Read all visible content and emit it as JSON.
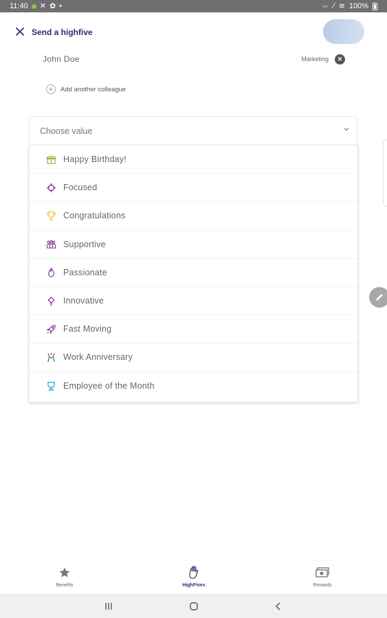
{
  "status_bar": {
    "time": "11:40",
    "battery": "100%"
  },
  "header": {
    "title": "Send a highfive"
  },
  "recipient": {
    "name": "John Doe",
    "department": "Marketing"
  },
  "add_colleague": {
    "label": "Add another colleague"
  },
  "select": {
    "label": "Choose value"
  },
  "options": [
    {
      "label": "Happy Birthday!",
      "icon": "gift-icon",
      "color": "#8bc34a"
    },
    {
      "label": "Focused",
      "icon": "crosshair-icon",
      "color": "#7b2d8e"
    },
    {
      "label": "Congratulations",
      "icon": "trophy-icon",
      "color": "#f4c430"
    },
    {
      "label": "Supportive",
      "icon": "team-icon",
      "color": "#7b2d8e"
    },
    {
      "label": "Passionate",
      "icon": "flame-icon",
      "color": "#7b2d8e"
    },
    {
      "label": "Innovative",
      "icon": "bulb-icon",
      "color": "#7b2d8e"
    },
    {
      "label": "Fast Moving",
      "icon": "rocket-icon",
      "color": "#7b2d8e"
    },
    {
      "label": "Work Anniversary",
      "icon": "celebrate-icon",
      "color": "#2e7d32"
    },
    {
      "label": "Employee of the Month",
      "icon": "award-cup-icon",
      "color": "#29a3d8"
    }
  ],
  "bottom_nav": [
    {
      "label": "Benefits",
      "icon": "star-icon"
    },
    {
      "label": "HighFives",
      "icon": "hand-icon",
      "active": true
    },
    {
      "label": "Rewards",
      "icon": "cash-icon"
    }
  ],
  "colors": {
    "primary": "#2a2e6b",
    "send_gradient_start": "#b9cbe8",
    "send_gradient_end": "#d8def3"
  }
}
